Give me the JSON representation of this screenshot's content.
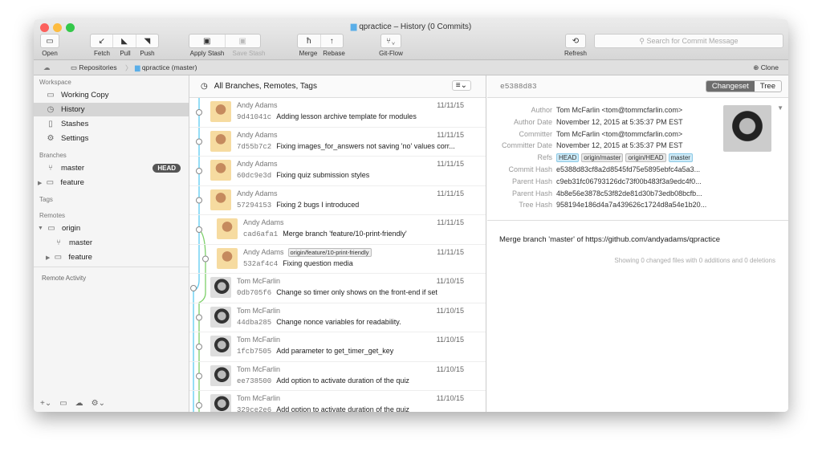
{
  "window": {
    "title": "qpractice – History (0 Commits)"
  },
  "toolbar": {
    "open": "Open",
    "fetch": "Fetch",
    "pull": "Pull",
    "push": "Push",
    "apply_stash": "Apply Stash",
    "save_stash": "Save Stash",
    "merge": "Merge",
    "rebase": "Rebase",
    "gitflow": "Git-Flow",
    "refresh": "Refresh",
    "search_placeholder": "Search for Commit Message"
  },
  "breadcrumb": {
    "repositories": "Repositories",
    "repo": "qpractice (master)",
    "clone": "Clone"
  },
  "sidebar": {
    "workspace": "Workspace",
    "items": [
      {
        "label": "Working Copy",
        "icon": "folder-icon"
      },
      {
        "label": "History",
        "icon": "clock-icon",
        "selected": true
      },
      {
        "label": "Stashes",
        "icon": "clipboard-icon"
      },
      {
        "label": "Settings",
        "icon": "gear-icon"
      }
    ],
    "branches": "Branches",
    "branch_items": [
      {
        "label": "master",
        "badge": "HEAD"
      },
      {
        "label": "feature"
      }
    ],
    "tags": "Tags",
    "remotes": "Remotes",
    "remote_items": [
      {
        "label": "origin"
      },
      {
        "label": "master"
      },
      {
        "label": "feature"
      }
    ],
    "remote_activity": "Remote Activity"
  },
  "list": {
    "filter": "All Branches, Remotes, Tags",
    "commits": [
      {
        "author": "Andy Adams",
        "hash": "9d41041c",
        "message": "Adding lesson archive template for modules",
        "date": "11/11/15",
        "avatar": "andy"
      },
      {
        "author": "Andy Adams",
        "hash": "7d55b7c2",
        "message": "Fixing images_for_answers not saving 'no' values corr...",
        "date": "11/11/15",
        "avatar": "andy"
      },
      {
        "author": "Andy Adams",
        "hash": "60dc9e3d",
        "message": "Fixing quiz submission styles",
        "date": "11/11/15",
        "avatar": "andy"
      },
      {
        "author": "Andy Adams",
        "hash": "57294153",
        "message": "Fixing 2 bugs I introduced",
        "date": "11/11/15",
        "avatar": "andy"
      },
      {
        "author": "Andy Adams",
        "hash": "cad6afa1",
        "message": "Merge branch 'feature/10-print-friendly'",
        "date": "11/11/15",
        "avatar": "andy"
      },
      {
        "author": "Andy Adams",
        "hash": "532af4c4",
        "message": "Fixing question media",
        "date": "11/11/15",
        "avatar": "andy",
        "tag": "origin/feature/10-print-friendly"
      },
      {
        "author": "Tom McFarlin",
        "hash": "0db705f6",
        "message": "Change so timer only shows on the front-end if set",
        "date": "11/10/15",
        "avatar": "tom"
      },
      {
        "author": "Tom McFarlin",
        "hash": "44dba285",
        "message": "Change nonce variables for readability.",
        "date": "11/10/15",
        "avatar": "tom"
      },
      {
        "author": "Tom McFarlin",
        "hash": "1fcb7505",
        "message": "Add parameter to get_timer_get_key",
        "date": "11/10/15",
        "avatar": "tom"
      },
      {
        "author": "Tom McFarlin",
        "hash": "ee738500",
        "message": "Add option to activate duration of the quiz",
        "date": "11/10/15",
        "avatar": "tom"
      },
      {
        "author": "Tom McFarlin",
        "hash": "329ce2e6",
        "message": "Add option to activate duration of the quiz",
        "date": "11/10/15",
        "avatar": "tom"
      }
    ]
  },
  "detail": {
    "hash": "e5388d83",
    "tabs": [
      "Changeset",
      "Tree"
    ],
    "fields": [
      {
        "k": "Author",
        "v": "Tom McFarlin <tom@tommcfarlin.com>"
      },
      {
        "k": "Author Date",
        "v": "November 12, 2015 at 5:35:37 PM EST"
      },
      {
        "k": "Committer",
        "v": "Tom McFarlin <tom@tommcfarlin.com>"
      },
      {
        "k": "Committer Date",
        "v": "November 12, 2015 at 5:35:37 PM EST"
      },
      {
        "k": "Refs",
        "v": ""
      },
      {
        "k": "Commit Hash",
        "v": "e5388d83cf8a2d8545fd75e5895ebfc4a5a3..."
      },
      {
        "k": "Parent Hash",
        "v": "c9eb31fc06793126dc73f00b483f3a9edc4f0..."
      },
      {
        "k": "Parent Hash",
        "v": "4b8e56e3878c53f82de81d30b73edb08bcfb..."
      },
      {
        "k": "Tree Hash",
        "v": "958194e186d4a7a439626c1724d8a54e1b20..."
      }
    ],
    "refs": [
      "HEAD",
      "origin/master",
      "origin/HEAD",
      "master"
    ],
    "message": "Merge branch 'master' of https://github.com/andyadams/qpractice",
    "summary": "Showing 0 changed files with 0 additions and 0 deletions"
  },
  "colors": {
    "graph_blue": "#5ccbf0",
    "graph_green": "#7ed06a",
    "selected": "#d5d5d5"
  }
}
